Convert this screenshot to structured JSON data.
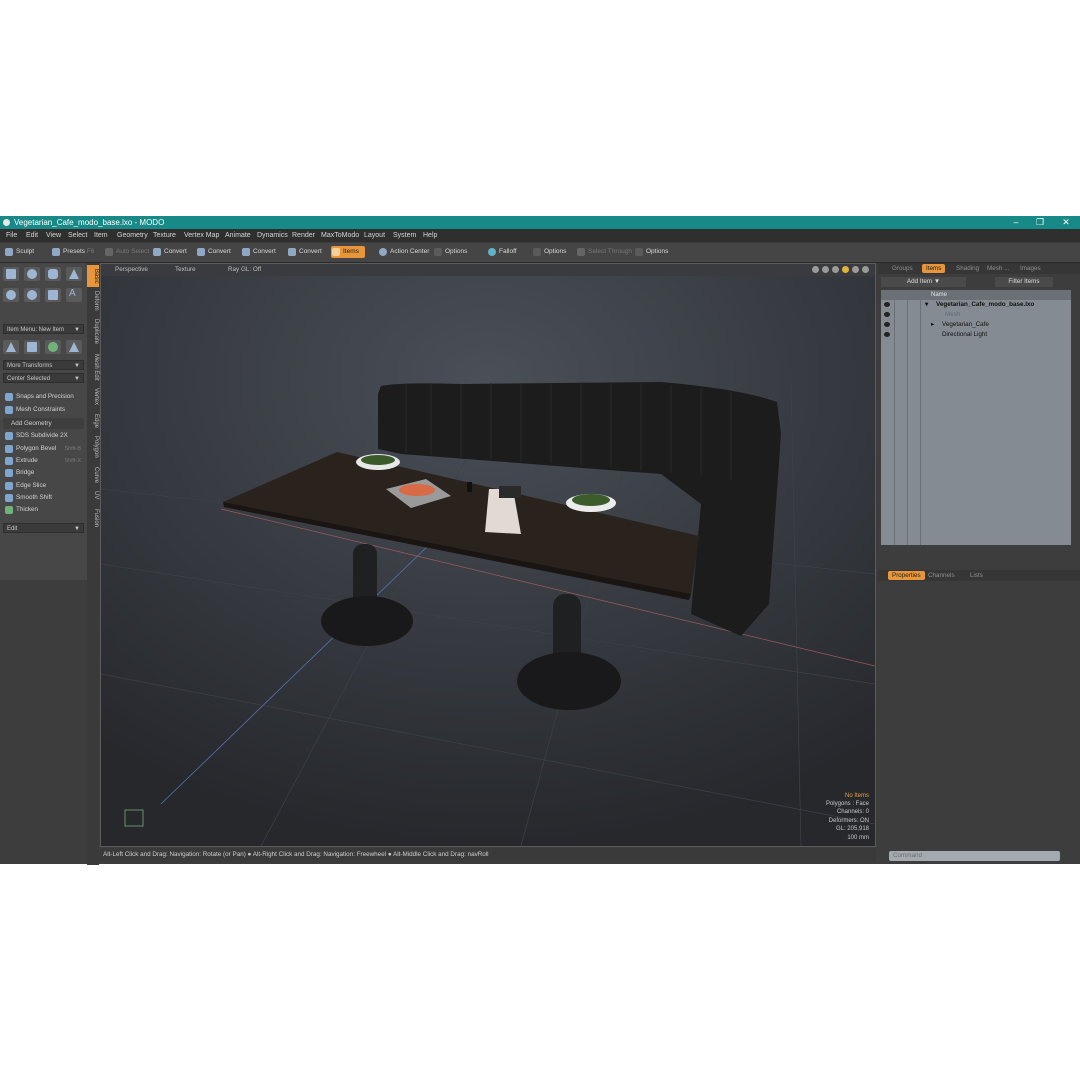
{
  "window": {
    "title": "Vegetarian_Cafe_modo_base.lxo - MODO",
    "controls": {
      "minimize": "–",
      "maximize": "❐",
      "close": "✕"
    }
  },
  "menu": [
    "File",
    "Edit",
    "View",
    "Select",
    "Item",
    "Geometry",
    "Texture",
    "Vertex Map",
    "Animate",
    "Dynamics",
    "Render",
    "MaxToModo",
    "Layout",
    "System",
    "Help"
  ],
  "toolbar": {
    "sculpt": "Sculpt",
    "presets": "Presets",
    "presets_key": "F6",
    "auto_select": "Auto Select",
    "convert": "Convert",
    "items": "Items",
    "action_center": "Action Center",
    "options": "Options",
    "falloff": "Falloff",
    "select_through": "Select Through"
  },
  "left": {
    "item_menu": "Item Menu: New Item",
    "more_transforms": "More Transforms",
    "center_selected": "Center Selected",
    "snaps": "Snaps and Precision",
    "mesh_constraints": "Mesh Constraints",
    "add_geometry": "Add Geometry",
    "tools": [
      {
        "label": "SDS Subdivide 2X",
        "key": ""
      },
      {
        "label": "Polygon Bevel",
        "key": "Shift-B"
      },
      {
        "label": "Extrude",
        "key": "Shift-X"
      },
      {
        "label": "Bridge",
        "key": ""
      },
      {
        "label": "Edge Slice",
        "key": ""
      },
      {
        "label": "Smooth Shift",
        "key": ""
      },
      {
        "label": "Thicken",
        "key": ""
      }
    ],
    "edit": "Edit"
  },
  "vtabs": [
    "Basic",
    "Deform",
    "Duplicate",
    "Mesh Edit",
    "Vertex",
    "Edge",
    "Polygon",
    "Curve",
    "UV",
    "Fusion"
  ],
  "viewport": {
    "header": {
      "view": "Perspective",
      "shading": "Texture",
      "raygl": "Ray GL: Off"
    },
    "stats": {
      "no_items": "No Items",
      "polygons": "Polygons : Face",
      "channels": "Channels: 0",
      "deformers": "Deformers: ON",
      "gl": "GL: 205,918",
      "scale": "100 mm"
    }
  },
  "status": "Alt-Left Click and Drag: Navigation: Rotate (or Pan) ● Alt-Right Click and Drag: Navigation: Freewheel ● Alt-Middle Click and Drag: navRoll",
  "right": {
    "tabs": [
      "Groups",
      "Items",
      "Shading",
      "Mesh ...",
      "Images"
    ],
    "add_item": "Add Item",
    "filter_items": "Filter Items",
    "col_name": "Name",
    "tree": [
      {
        "label": "Vegetarian_Cafe_modo_base.lxo"
      },
      {
        "label": "Mesh"
      },
      {
        "label": "Vegetarian_Cafe"
      },
      {
        "label": "Directional Light"
      }
    ],
    "prop_tabs": [
      "Properties",
      "Channels",
      "Lists"
    ],
    "command_placeholder": "Command"
  }
}
